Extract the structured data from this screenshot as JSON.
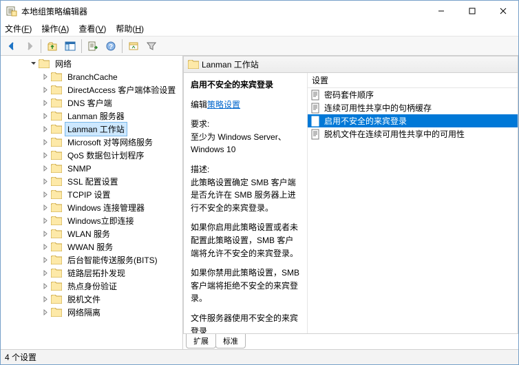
{
  "window_title": "本地组策略编辑器",
  "menus": {
    "file": "文件(F)",
    "action": "操作(A)",
    "view": "查看(V)",
    "help": "帮助(H)"
  },
  "tree": {
    "parent": "网络",
    "items": [
      "BranchCache",
      "DirectAccess 客户端体验设置",
      "DNS 客户端",
      "Lanman 服务器",
      "Lanman 工作站",
      "Microsoft 对等网络服务",
      "QoS 数据包计划程序",
      "SNMP",
      "SSL 配置设置",
      "TCPIP 设置",
      "Windows 连接管理器",
      "Windows立即连接",
      "WLAN 服务",
      "WWAN 服务",
      "后台智能传送服务(BITS)",
      "链路层拓扑发现",
      "热点身份验证",
      "脱机文件",
      "网络隔离"
    ],
    "selected_index": 4
  },
  "heading": "Lanman 工作站",
  "detail": {
    "title": "启用不安全的来宾登录",
    "edit_label": "编辑",
    "edit_link": "策略设置",
    "req_label": "要求:",
    "req_text": "至少为 Windows Server、Windows 10",
    "desc_label": "描述:",
    "desc1": "此策略设置确定 SMB 客户端是否允许在 SMB 服务器上进行不安全的来宾登录。",
    "desc2": "如果你启用此策略设置或者未配置此策略设置，SMB 客户端将允许不安全的来宾登录。",
    "desc3": "如果你禁用此策略设置，SMB 客户端将拒绝不安全的来宾登录。",
    "desc4": "文件服务器使用不安全的来宾登录"
  },
  "list": {
    "header": "设置",
    "items": [
      "密码套件顺序",
      "连续可用性共享中的句柄缓存",
      "启用不安全的来宾登录",
      "脱机文件在连续可用性共享中的可用性"
    ],
    "selected_index": 2
  },
  "tabs": {
    "extended": "扩展",
    "standard": "标准"
  },
  "statusbar": "4 个设置"
}
